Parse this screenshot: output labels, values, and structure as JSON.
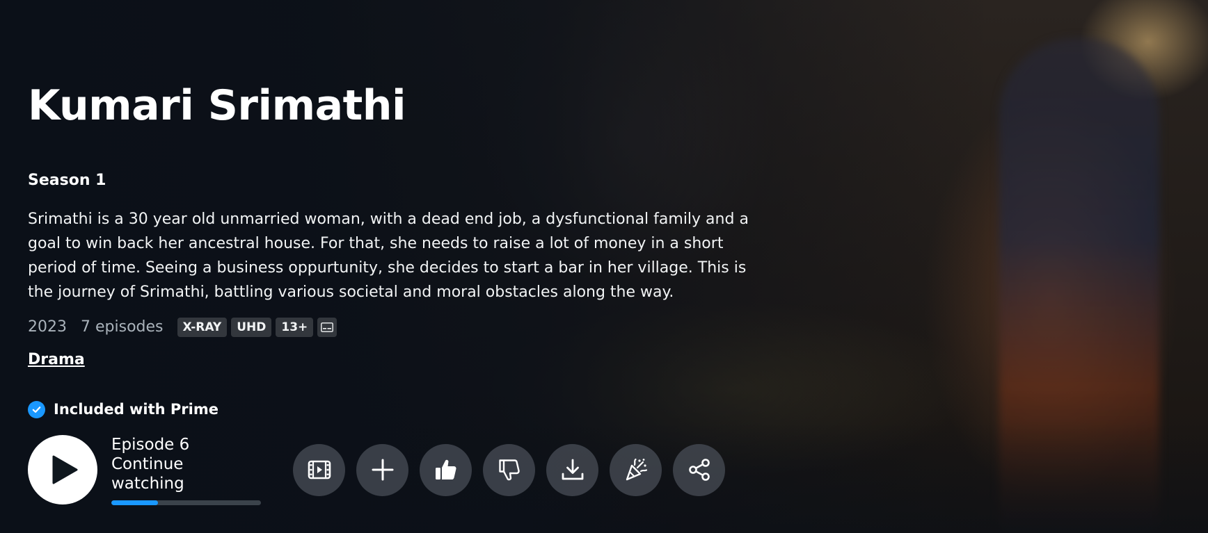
{
  "show": {
    "title": "Kumari Srimathi",
    "season": "Season 1",
    "synopsis": "Srimathi is a 30 year old unmarried woman, with a dead end job, a dysfunctional family and a goal to win back her ancestral house. For that, she needs to raise a lot of money in a short period of time. Seeing a business oppurtunity, she decides to start a bar in her village. This is the journey of Srimathi, battling various societal and moral obstacles along the way.",
    "year": "2023",
    "episodes": "7 episodes",
    "badges": [
      "X-RAY",
      "UHD",
      "13+"
    ],
    "subtitles_icon": "subtitles-icon",
    "genre": "Drama"
  },
  "availability": {
    "label": "Included with Prime",
    "icon": "check-circle-icon",
    "accent": "#1a98ff"
  },
  "playback": {
    "episode_label": "Episode 6",
    "status_label": "Continue watching",
    "progress_percent": 31,
    "play_icon": "play-icon"
  },
  "actions": [
    {
      "name": "trailer-button",
      "icon": "trailer-icon"
    },
    {
      "name": "watchlist-button",
      "icon": "plus-icon"
    },
    {
      "name": "like-button",
      "icon": "thumbs-up-icon"
    },
    {
      "name": "dislike-button",
      "icon": "thumbs-down-icon"
    },
    {
      "name": "download-button",
      "icon": "download-icon"
    },
    {
      "name": "watch-party-button",
      "icon": "party-popper-icon"
    },
    {
      "name": "share-button",
      "icon": "share-icon"
    }
  ]
}
